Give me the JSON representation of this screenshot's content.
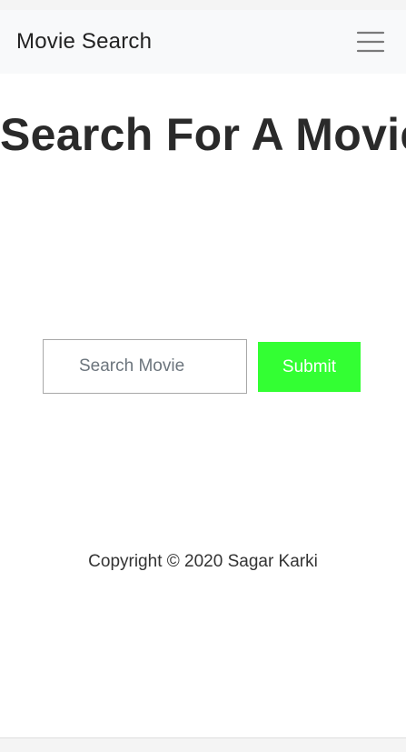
{
  "navbar": {
    "brand": "Movie Search",
    "menu_icon": "hamburger-menu-icon"
  },
  "main": {
    "heading": "Search For A Movie",
    "search": {
      "placeholder": "Search Movie",
      "value": ""
    },
    "submit_label": "Submit"
  },
  "footer": {
    "copyright": "Copyright © 2020 Sagar Karki"
  },
  "colors": {
    "submit_bg": "#33ff33",
    "navbar_bg": "#f8f9fa",
    "heading_text": "#2a2a2a"
  }
}
